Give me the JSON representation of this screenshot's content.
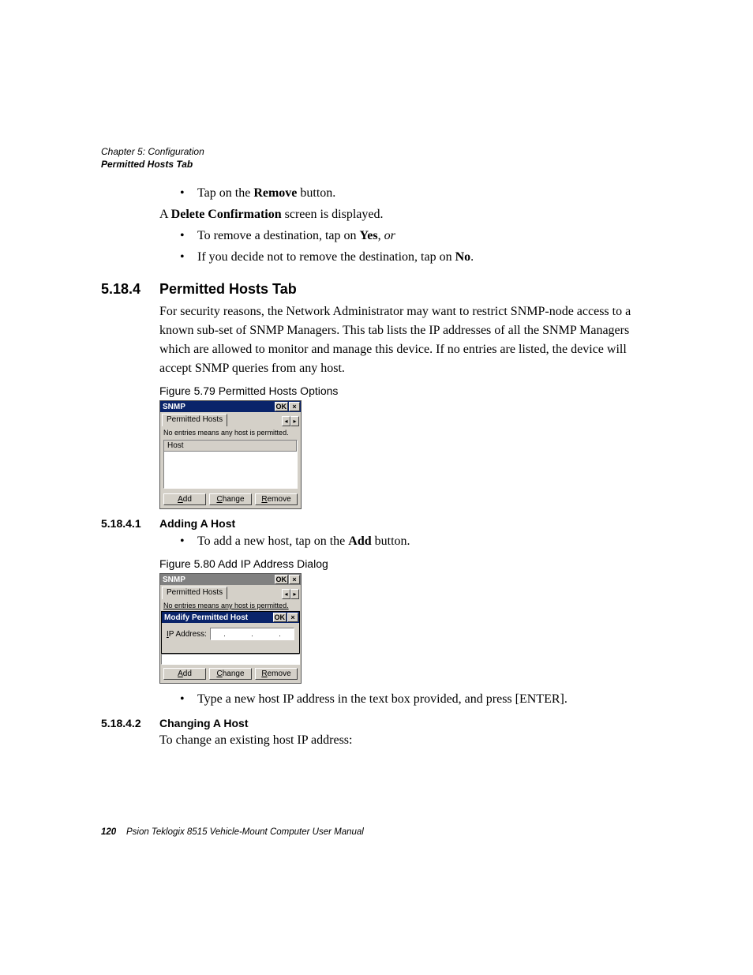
{
  "header": {
    "chapter": "Chapter 5: Configuration",
    "section": "Permitted Hosts Tab"
  },
  "intro": {
    "bullets1": [
      {
        "pre": "Tap on the ",
        "bold": "Remove",
        "post": " button."
      }
    ],
    "line1_pre": "A ",
    "line1_bold": "Delete Confirmation",
    "line1_post": " screen is displayed.",
    "bullets2": [
      {
        "pre": "To remove a destination, tap on ",
        "bold": "Yes",
        "post": ", ",
        "ital": "or"
      },
      {
        "pre": "If you decide not to remove the destination, tap on ",
        "bold": "No",
        "post": "."
      }
    ]
  },
  "h2": {
    "num": "5.18.4",
    "title": "Permitted Hosts Tab"
  },
  "body1": "For security reasons, the Network Administrator may want to restrict SNMP-node access to a known sub-set of SNMP Managers. This tab lists the IP addresses of all the SNMP Managers which are allowed to monitor and manage this device. If no entries are listed, the device will accept SNMP queries from any host.",
  "fig1": {
    "caption": "Figure 5.79 Permitted Hosts Options",
    "title": "SNMP",
    "ok": "OK",
    "tab": "Permitted Hosts",
    "note": "No entries means any host is permitted.",
    "col": "Host",
    "btn_add": "Add",
    "btn_add_mn": "A",
    "btn_change": "Change",
    "btn_change_mn": "C",
    "btn_remove": "Remove",
    "btn_remove_mn": "R"
  },
  "h3a": {
    "num": "5.18.4.1",
    "title": "Adding A Host"
  },
  "bullet3": {
    "pre": "To add a new host, tap on the ",
    "bold": "Add",
    "post": " button."
  },
  "fig2": {
    "caption": "Figure 5.80 Add IP Address Dialog",
    "outer_title": "SNMP",
    "ok": "OK",
    "tab": "Permitted Hosts",
    "note": "No entries means any host is permitted.",
    "inner_title": "Modify Permitted Host",
    "iplabel_mn": "I",
    "iplabel_rest": "P Address:",
    "btn_add": "Add",
    "btn_add_mn": "A",
    "btn_change": "Change",
    "btn_change_mn": "C",
    "btn_remove": "Remove",
    "btn_remove_mn": "R"
  },
  "bullet4": "Type a new host IP address in the text box provided, and press [ENTER].",
  "h3b": {
    "num": "5.18.4.2",
    "title": "Changing A Host"
  },
  "body2": "To change an existing host IP address:",
  "footer": {
    "page": "120",
    "title": "Psion Teklogix 8515 Vehicle-Mount Computer User Manual"
  }
}
